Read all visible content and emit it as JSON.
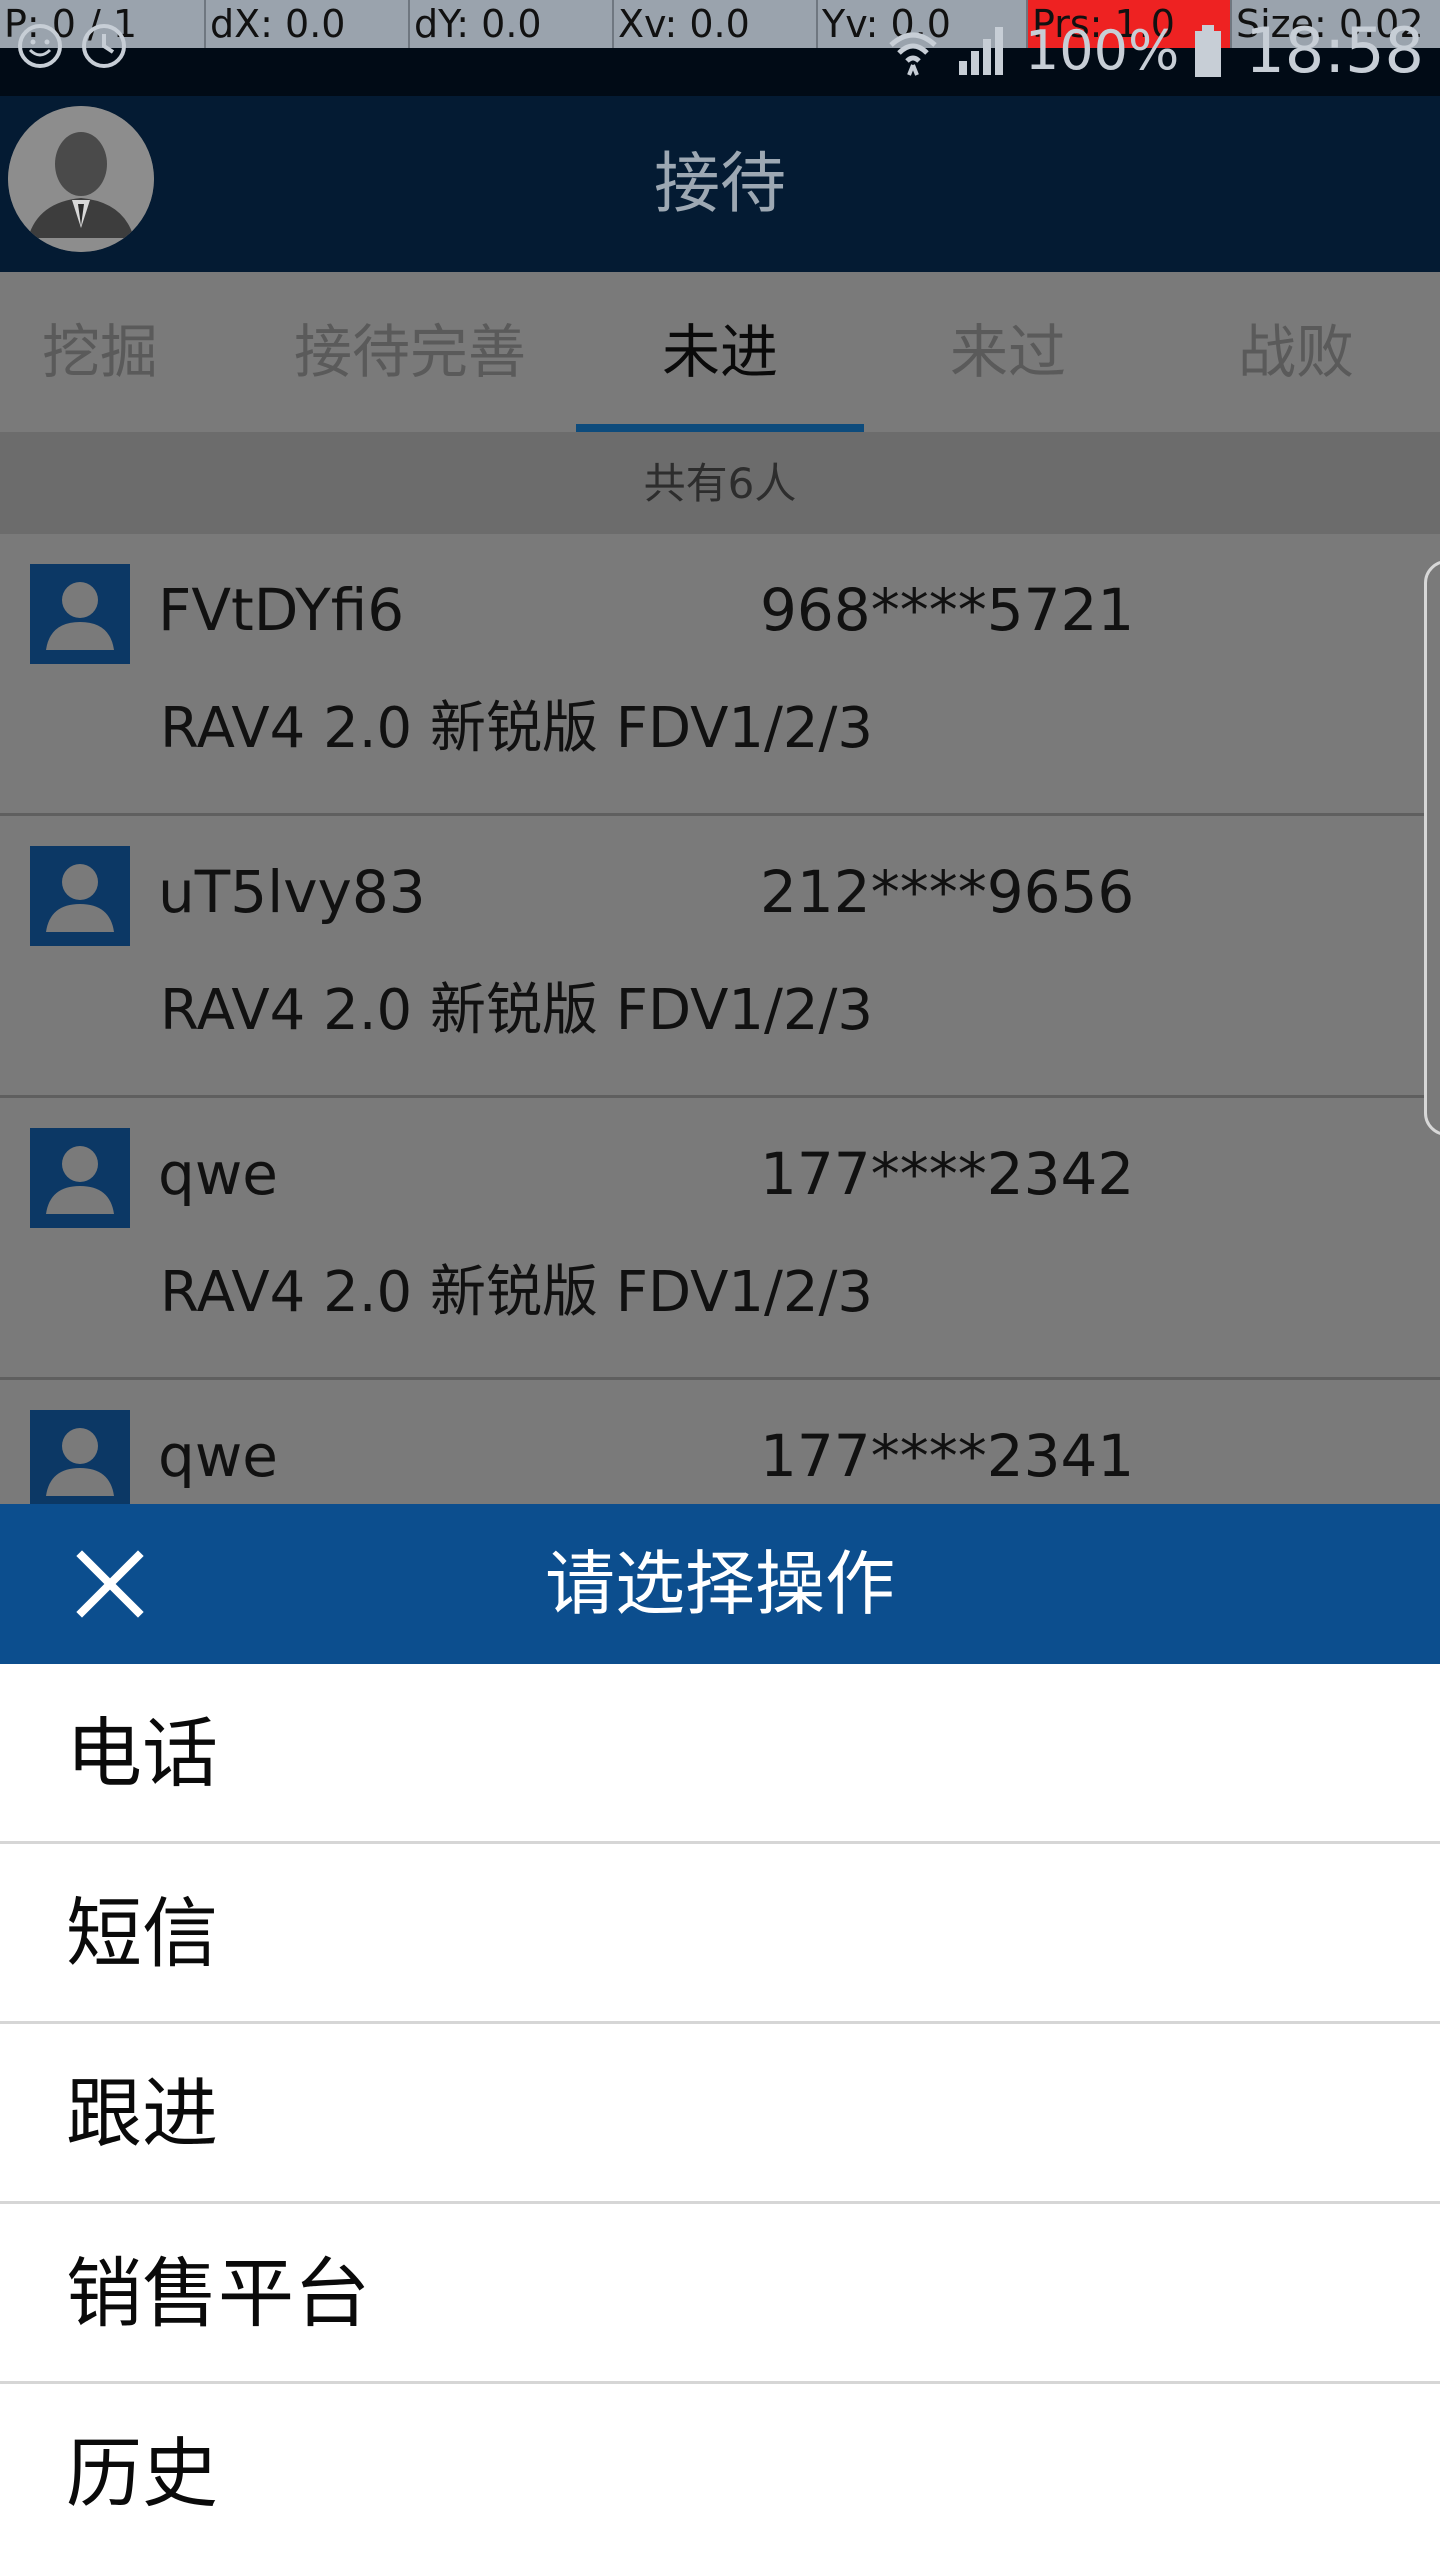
{
  "debug": {
    "p": "P: 0 / 1",
    "dx": "dX: 0.0",
    "dy": "dY: 0.0",
    "xv": "Xv: 0.0",
    "yv": "Yv: 0.0",
    "prs": "Prs: 1.0",
    "size": "Size: 0.02"
  },
  "status": {
    "battery": "100%",
    "time": "18:58"
  },
  "header": {
    "title": "接待"
  },
  "tabs": [
    {
      "label": "挖掘"
    },
    {
      "label": "接待完善"
    },
    {
      "label": "未进",
      "active": true
    },
    {
      "label": "来过"
    },
    {
      "label": "战败"
    }
  ],
  "count": "共有6人",
  "customers": [
    {
      "name": "FVtDYfi6",
      "phone": "968****5721",
      "model": "RAV4 2.0 新锐版 FDV1/2/3"
    },
    {
      "name": "uT5lvy83",
      "phone": "212****9656",
      "model": "RAV4 2.0 新锐版 FDV1/2/3"
    },
    {
      "name": "qwe",
      "phone": "177****2342",
      "model": "RAV4 2.0 新锐版 FDV1/2/3"
    },
    {
      "name": "qwe",
      "phone": "177****2341",
      "model": ""
    }
  ],
  "dialog": {
    "title": "请选择操作",
    "options": [
      {
        "label": "电话"
      },
      {
        "label": "短信"
      },
      {
        "label": "跟进"
      },
      {
        "label": "销售平台"
      },
      {
        "label": "历史"
      }
    ]
  },
  "colors": {
    "header_bg": "#041b33",
    "dialog_header_bg": "#0c4e8e",
    "tab_indicator": "#0d4b7c"
  }
}
